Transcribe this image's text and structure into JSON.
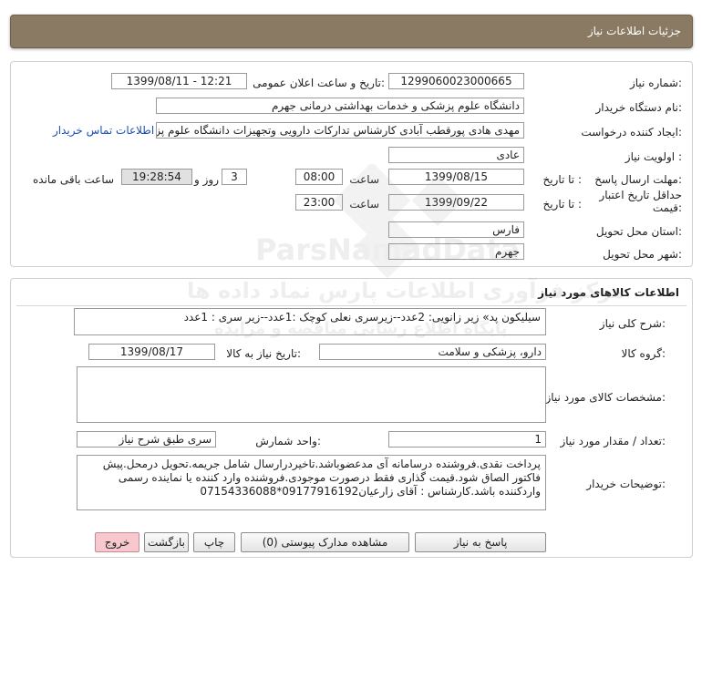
{
  "header": {
    "title": "جزئیات اطلاعات نیاز"
  },
  "general": {
    "need_number_label": "شماره نیاز:",
    "need_number": "1299060023000665",
    "announce_label": "تاریخ و ساعت اعلان عمومی:",
    "announce_value": "1399/08/11 - 12:21",
    "buyer_org_label": "نام دستگاه خریدار:",
    "buyer_org": "دانشگاه علوم پزشکی و خدمات بهداشتی درمانی جهرم",
    "requester_label": "ایجاد کننده درخواست:",
    "requester": "مهدی هادی پورقطب آبادی کارشناس تدارکات دارویی وتجهیزات دانشگاه علوم پزشکی",
    "contact_link": "اطلاعات تماس خریدار",
    "priority_label": "اولویت نیاز :",
    "priority": "عادی",
    "deadline_label": "مهلت ارسال پاسخ:",
    "until_date_label": "تا تاریخ :",
    "deadline_date": "1399/08/15",
    "time_label": "ساعت",
    "deadline_time": "08:00",
    "days_value": "3",
    "days_label": "روز و",
    "remaining_time": "19:28:54",
    "remaining_label": "ساعت باقی مانده",
    "validity_label_line1": "حداقل تاریخ اعتبار",
    "validity_label_line2": "قیمت:",
    "validity_until_label": "تا تاریخ :",
    "validity_date": "1399/09/22",
    "validity_time_label": "ساعت",
    "validity_time": "23:00",
    "province_label": "استان محل تحویل:",
    "province": "فارس",
    "city_label": "شهر محل تحویل:",
    "city": "جهرم"
  },
  "goods": {
    "section_title": "اطلاعات کالاهای مورد نیاز",
    "summary_label": "شرح کلی نیاز:",
    "summary": "سیلیکون پد» زیر زانویی: 2عدد--زیرسری نعلی کوچک :1عدد--زیر سری : 1عدد",
    "group_label": "گروه کالا:",
    "group": "دارو، پزشکی و سلامت",
    "need_date_label": "تاریخ نیاز به کالا:",
    "need_date": "1399/08/17",
    "specs_label": "مشخصات کالای مورد نیاز:",
    "specs": "",
    "qty_label": "تعداد / مقدار مورد نیاز:",
    "qty": "1",
    "unit_label": "واحد شمارش:",
    "unit": "سری طبق شرح نیاز",
    "buyer_notes_label": "توضیحات خریدار:",
    "buyer_notes": "پرداخت نقدی.فروشنده درسامانه آی مدعضوباشد.تاخیردرارسال شامل جریمه.تحویل درمحل.پیش فاکتور الصاق شود.قیمت گذاری فقط درصورت موجودی.فروشنده وارد کننده یا نماینده رسمی واردکننده باشد.کارشناس : آقای زارعیان09177916192*07154336088"
  },
  "buttons": {
    "reply": "پاسخ به نیاز",
    "attachments": "مشاهده مدارک پیوستی (0)",
    "print": "چاپ",
    "back": "بازگشت",
    "exit": "خروج"
  },
  "watermark": {
    "brand_latin": "ParsNamadData",
    "brand_fa": "مرکز فرآوری اطلاعات پارس نماد داده ها",
    "tagline_fa": "پایگاه اطلاع رسانی مناقصه و مزایده"
  },
  "colors": {
    "header_bg": "#8a7a63",
    "remaining_bg": "#e1e1e1",
    "exit_bg": "#f7c9cf",
    "link": "#1a4fb5"
  }
}
